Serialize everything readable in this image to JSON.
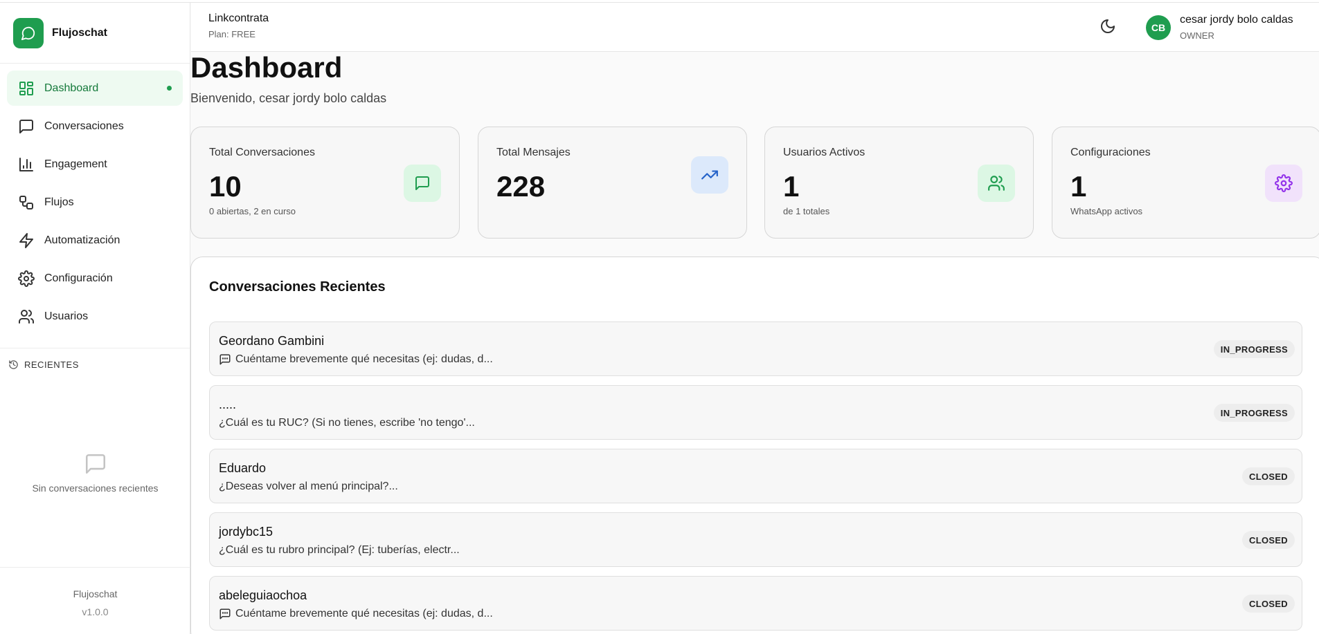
{
  "brand": {
    "name": "Flujoschat",
    "accent": "#1f9d4f"
  },
  "sidebar": {
    "items": [
      {
        "label": "Dashboard",
        "icon": "dashboard-icon",
        "active": true
      },
      {
        "label": "Conversaciones",
        "icon": "message-square-icon"
      },
      {
        "label": "Engagement",
        "icon": "bar-chart-icon"
      },
      {
        "label": "Flujos",
        "icon": "workflow-icon"
      },
      {
        "label": "Automatización",
        "icon": "lightning-icon"
      },
      {
        "label": "Configuración",
        "icon": "gear-icon"
      },
      {
        "label": "Usuarios",
        "icon": "users-icon"
      }
    ],
    "recents_title": "RECIENTES",
    "empty_text": "Sin conversaciones recientes",
    "footer_name": "Flujoschat",
    "footer_version": "v1.0.0"
  },
  "header": {
    "org_name": "Linkcontrata",
    "org_plan": "Plan: FREE",
    "avatar_initials": "CB",
    "user_name": "cesar jordy bolo caldas",
    "user_role": "OWNER"
  },
  "main": {
    "title": "Dashboard",
    "subtitle": "Bienvenido, cesar jordy bolo caldas",
    "stats": [
      {
        "label": "Total Conversaciones",
        "value": "10",
        "sub": "0 abiertas, 2 en curso",
        "icon": "message-square-icon",
        "icon_bg": "#dcf7e4",
        "icon_color": "#1f9d4f"
      },
      {
        "label": "Total Mensajes",
        "value": "228",
        "sub": "",
        "icon": "trending-up-icon",
        "icon_bg": "#dce9fb",
        "icon_color": "#2563c9"
      },
      {
        "label": "Usuarios Activos",
        "value": "1",
        "sub": "de 1 totales",
        "icon": "users-icon",
        "icon_bg": "#dcf7e4",
        "icon_color": "#1f9d4f"
      },
      {
        "label": "Configuraciones",
        "value": "1",
        "sub": "WhatsApp activos",
        "icon": "gear-icon",
        "icon_bg": "#f1e2fb",
        "icon_color": "#9333ea"
      }
    ],
    "recent_title": "Conversaciones Recientes",
    "conversations": [
      {
        "name": "Geordano Gambini",
        "message": "Cuéntame brevemente qué necesitas (ej: dudas, d...",
        "status": "IN_PROGRESS",
        "has_icon": true
      },
      {
        "name": ".....",
        "message": "¿Cuál es tu RUC? (Si no tienes, escribe 'no tengo'...",
        "status": "IN_PROGRESS",
        "has_icon": false
      },
      {
        "name": "Eduardo",
        "message": "¿Deseas volver al menú principal?...",
        "status": "CLOSED",
        "has_icon": false
      },
      {
        "name": "jordybc15",
        "message": "¿Cuál es tu rubro principal? (Ej: tuberías, electr...",
        "status": "CLOSED",
        "has_icon": false
      },
      {
        "name": "abeleguiaochoa",
        "message": "Cuéntame brevemente qué necesitas (ej: dudas, d...",
        "status": "CLOSED",
        "has_icon": true
      }
    ]
  }
}
